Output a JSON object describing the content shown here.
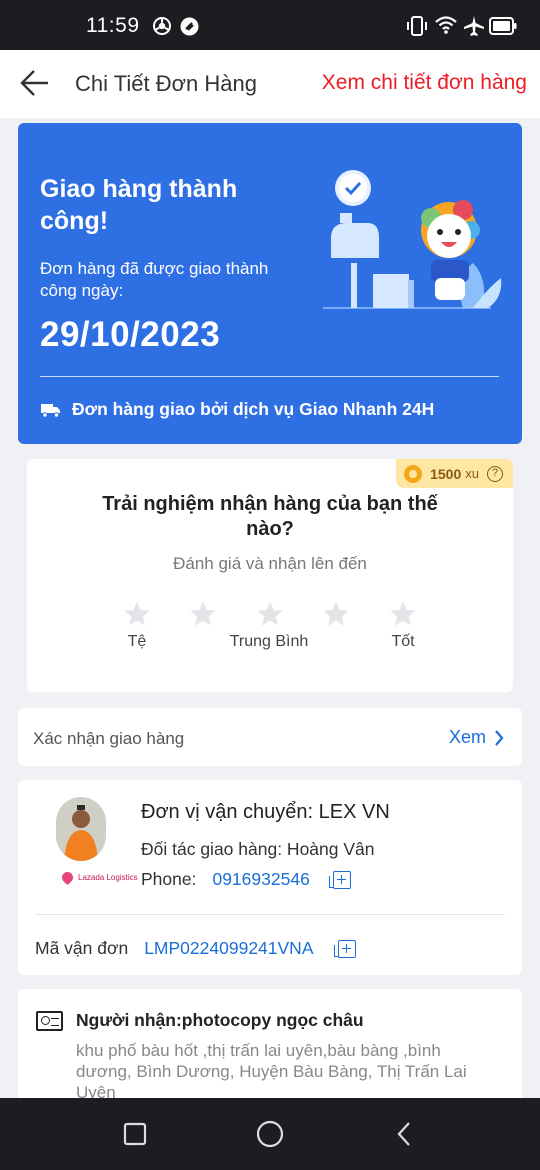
{
  "status_bar": {
    "time": "11:59",
    "left_icons": [
      "chrome-icon",
      "app-notification-icon"
    ],
    "right_icons": [
      "vibrate-icon",
      "wifi-icon",
      "airplane-icon",
      "battery-icon"
    ]
  },
  "header": {
    "title": "Chi Tiết Đơn Hàng",
    "detail_link": "Xem chi tiết đơn hàng",
    "back_icon": "arrow-left-icon"
  },
  "delivery": {
    "headline": "Giao hàng thành công!",
    "sub": "Đơn hàng đã được giao thành công ngày:",
    "date": "29/10/2023",
    "service": "Đơn hàng giao bởi dịch vụ Giao Nhanh 24H",
    "service_icon": "truck-icon",
    "colors": {
      "background": "#2f6fe4",
      "text": "#ffffff"
    }
  },
  "rating": {
    "badge": {
      "amount": "1500",
      "unit": "xu",
      "help": "?"
    },
    "question": "Trải nghiệm nhận hàng của bạn thế nào?",
    "hint": "Đánh giá và nhận lên đến",
    "stars": 5,
    "selected": 0,
    "labels": {
      "low": "Tệ",
      "mid": "Trung Bình",
      "high": "Tốt"
    }
  },
  "confirm": {
    "label": "Xác nhận giao hàng",
    "action": "Xem"
  },
  "carrier": {
    "name": "Đơn vị vận chuyển: LEX VN",
    "partner": "Đối tác giao hàng: Hoàng Vân",
    "phone_label": "Phone:",
    "phone": "0916932546",
    "logo_text": "Lazada Logistics",
    "tracking_label": "Mã vận đơn",
    "tracking_number": "LMP0224099241VNA"
  },
  "receiver": {
    "name": "Người nhận:photocopy ngọc châu",
    "address": "khu phố bàu hốt ,thị trấn lai uyên,bàu bàng ,bình dương, Bình Dương, Huyện Bàu Bàng, Thị Trấn Lai Uyên"
  },
  "nav": {
    "buttons": [
      "recents-square-icon",
      "home-circle-icon",
      "back-triangle-icon"
    ]
  }
}
